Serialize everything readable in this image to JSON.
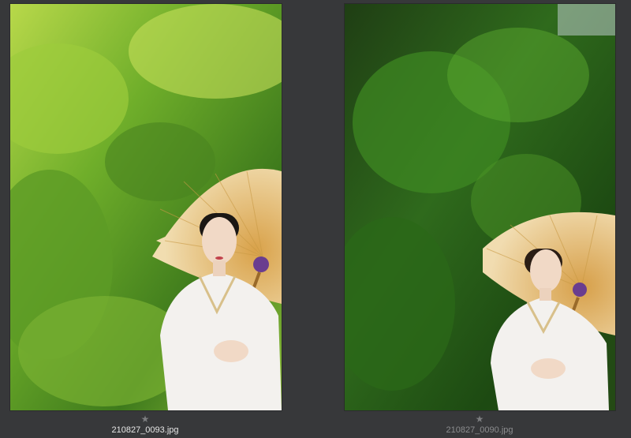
{
  "thumbnails": [
    {
      "filename": "210827_0093.jpg",
      "star_glyph": "★",
      "selected": true
    },
    {
      "filename": "210827_0090.jpg",
      "star_glyph": "★",
      "selected": false
    }
  ],
  "colors": {
    "background": "#37383a",
    "selected_label": "#e6e6e6",
    "unselected_label": "#8b8c8e",
    "star": "#7c7d7f",
    "umbrella": "#e8c98a",
    "kimono": "#f3f1ee"
  }
}
